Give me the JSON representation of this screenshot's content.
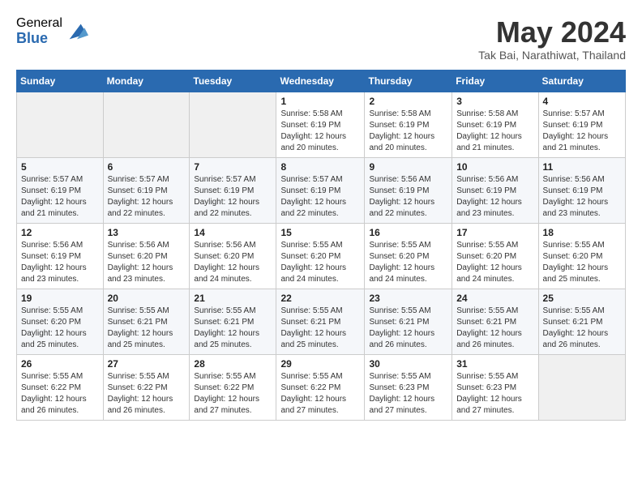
{
  "logo": {
    "general": "General",
    "blue": "Blue"
  },
  "title": "May 2024",
  "location": "Tak Bai, Narathiwat, Thailand",
  "weekdays": [
    "Sunday",
    "Monday",
    "Tuesday",
    "Wednesday",
    "Thursday",
    "Friday",
    "Saturday"
  ],
  "weeks": [
    [
      {
        "day": "",
        "info": ""
      },
      {
        "day": "",
        "info": ""
      },
      {
        "day": "",
        "info": ""
      },
      {
        "day": "1",
        "info": "Sunrise: 5:58 AM\nSunset: 6:19 PM\nDaylight: 12 hours\nand 20 minutes."
      },
      {
        "day": "2",
        "info": "Sunrise: 5:58 AM\nSunset: 6:19 PM\nDaylight: 12 hours\nand 20 minutes."
      },
      {
        "day": "3",
        "info": "Sunrise: 5:58 AM\nSunset: 6:19 PM\nDaylight: 12 hours\nand 21 minutes."
      },
      {
        "day": "4",
        "info": "Sunrise: 5:57 AM\nSunset: 6:19 PM\nDaylight: 12 hours\nand 21 minutes."
      }
    ],
    [
      {
        "day": "5",
        "info": "Sunrise: 5:57 AM\nSunset: 6:19 PM\nDaylight: 12 hours\nand 21 minutes."
      },
      {
        "day": "6",
        "info": "Sunrise: 5:57 AM\nSunset: 6:19 PM\nDaylight: 12 hours\nand 22 minutes."
      },
      {
        "day": "7",
        "info": "Sunrise: 5:57 AM\nSunset: 6:19 PM\nDaylight: 12 hours\nand 22 minutes."
      },
      {
        "day": "8",
        "info": "Sunrise: 5:57 AM\nSunset: 6:19 PM\nDaylight: 12 hours\nand 22 minutes."
      },
      {
        "day": "9",
        "info": "Sunrise: 5:56 AM\nSunset: 6:19 PM\nDaylight: 12 hours\nand 22 minutes."
      },
      {
        "day": "10",
        "info": "Sunrise: 5:56 AM\nSunset: 6:19 PM\nDaylight: 12 hours\nand 23 minutes."
      },
      {
        "day": "11",
        "info": "Sunrise: 5:56 AM\nSunset: 6:19 PM\nDaylight: 12 hours\nand 23 minutes."
      }
    ],
    [
      {
        "day": "12",
        "info": "Sunrise: 5:56 AM\nSunset: 6:19 PM\nDaylight: 12 hours\nand 23 minutes."
      },
      {
        "day": "13",
        "info": "Sunrise: 5:56 AM\nSunset: 6:20 PM\nDaylight: 12 hours\nand 23 minutes."
      },
      {
        "day": "14",
        "info": "Sunrise: 5:56 AM\nSunset: 6:20 PM\nDaylight: 12 hours\nand 24 minutes."
      },
      {
        "day": "15",
        "info": "Sunrise: 5:55 AM\nSunset: 6:20 PM\nDaylight: 12 hours\nand 24 minutes."
      },
      {
        "day": "16",
        "info": "Sunrise: 5:55 AM\nSunset: 6:20 PM\nDaylight: 12 hours\nand 24 minutes."
      },
      {
        "day": "17",
        "info": "Sunrise: 5:55 AM\nSunset: 6:20 PM\nDaylight: 12 hours\nand 24 minutes."
      },
      {
        "day": "18",
        "info": "Sunrise: 5:55 AM\nSunset: 6:20 PM\nDaylight: 12 hours\nand 25 minutes."
      }
    ],
    [
      {
        "day": "19",
        "info": "Sunrise: 5:55 AM\nSunset: 6:20 PM\nDaylight: 12 hours\nand 25 minutes."
      },
      {
        "day": "20",
        "info": "Sunrise: 5:55 AM\nSunset: 6:21 PM\nDaylight: 12 hours\nand 25 minutes."
      },
      {
        "day": "21",
        "info": "Sunrise: 5:55 AM\nSunset: 6:21 PM\nDaylight: 12 hours\nand 25 minutes."
      },
      {
        "day": "22",
        "info": "Sunrise: 5:55 AM\nSunset: 6:21 PM\nDaylight: 12 hours\nand 25 minutes."
      },
      {
        "day": "23",
        "info": "Sunrise: 5:55 AM\nSunset: 6:21 PM\nDaylight: 12 hours\nand 26 minutes."
      },
      {
        "day": "24",
        "info": "Sunrise: 5:55 AM\nSunset: 6:21 PM\nDaylight: 12 hours\nand 26 minutes."
      },
      {
        "day": "25",
        "info": "Sunrise: 5:55 AM\nSunset: 6:21 PM\nDaylight: 12 hours\nand 26 minutes."
      }
    ],
    [
      {
        "day": "26",
        "info": "Sunrise: 5:55 AM\nSunset: 6:22 PM\nDaylight: 12 hours\nand 26 minutes."
      },
      {
        "day": "27",
        "info": "Sunrise: 5:55 AM\nSunset: 6:22 PM\nDaylight: 12 hours\nand 26 minutes."
      },
      {
        "day": "28",
        "info": "Sunrise: 5:55 AM\nSunset: 6:22 PM\nDaylight: 12 hours\nand 27 minutes."
      },
      {
        "day": "29",
        "info": "Sunrise: 5:55 AM\nSunset: 6:22 PM\nDaylight: 12 hours\nand 27 minutes."
      },
      {
        "day": "30",
        "info": "Sunrise: 5:55 AM\nSunset: 6:23 PM\nDaylight: 12 hours\nand 27 minutes."
      },
      {
        "day": "31",
        "info": "Sunrise: 5:55 AM\nSunset: 6:23 PM\nDaylight: 12 hours\nand 27 minutes."
      },
      {
        "day": "",
        "info": ""
      }
    ]
  ]
}
